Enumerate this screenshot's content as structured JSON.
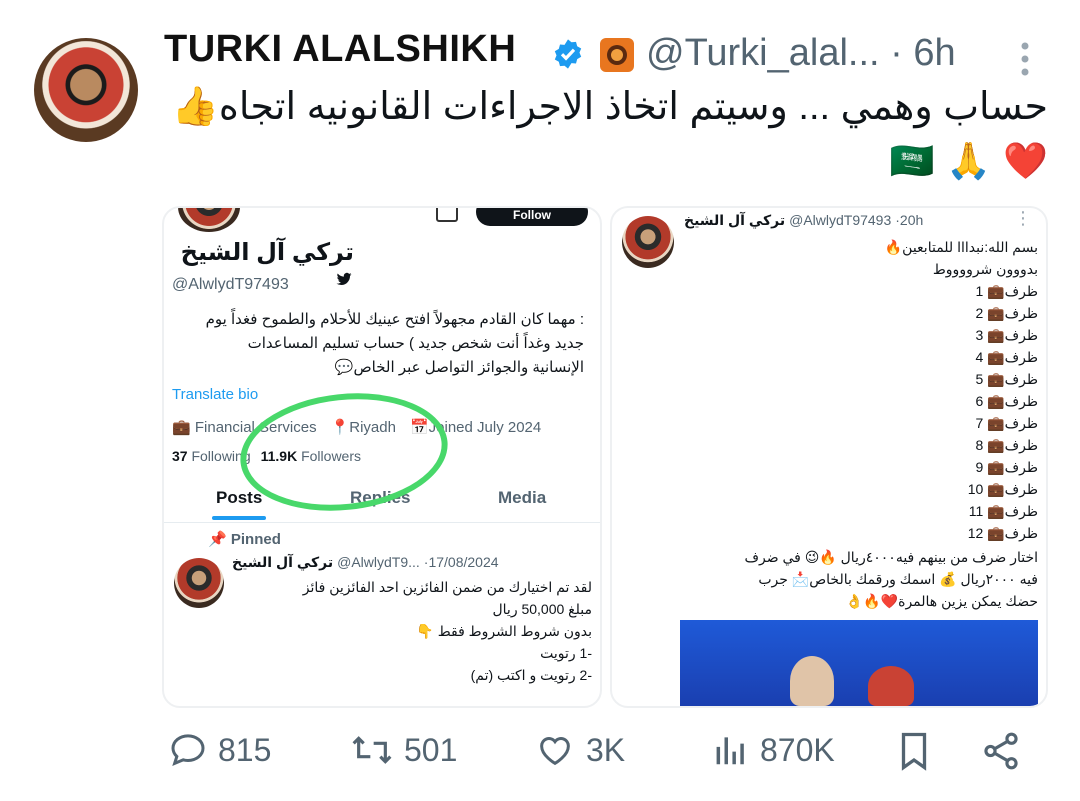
{
  "header": {
    "display_name": "TURKI ALALSHIKH",
    "handle": "@Turki_alal...",
    "time": "· 6h"
  },
  "tweet": {
    "text": "حساب وهمي ... وسيتم اتخاذ الاجراءات القانونيه اتجاه👍",
    "emoji_line": [
      "🇸🇦",
      "🙏",
      "❤️"
    ]
  },
  "left_card": {
    "follow_label": "Follow",
    "profile_name": "تركي آل الشيخ",
    "profile_handle": "@AlwlydT97493",
    "bio_lines": [
      ": مهما كان القادم مجهولاً افتح عينيك للأحلام والطموح فغداً يوم",
      "جديد وغداً أنت شخص جديد ) حساب تسليم المساعدات",
      "الإنسانية والجوائز التواصل عبر الخاص💬"
    ],
    "translate_bio": "Translate bio",
    "category": "Financial Services",
    "location": "Riyadh",
    "joined": "Joined July 2024",
    "following_count": "37",
    "following_label": "Following",
    "followers_count": "11.9K",
    "followers_label": "Followers",
    "tabs": [
      "Posts",
      "Replies",
      "Media"
    ],
    "pinned_label": "Pinned",
    "post": {
      "name": "تركي آل الشيخ",
      "handle": "@AlwlydT9...",
      "date": "·17/08/2024",
      "lines": [
        "لقد تم اختيارك من ضمن الفائزين احد الفائزين فائز",
        "مبلغ 50,000 ريال",
        "بدون شروط الشروط فقط 👇",
        "-1 رتويت",
        "-2 رتويت و اكتب (تم)"
      ]
    }
  },
  "right_card": {
    "name": "تركي آل الشيخ",
    "handle": "@AlwlydT97493",
    "time": "·20h",
    "line1": "بسم الله:نبدااا للمتابعين🔥",
    "line2": "بدووون شرووووط",
    "items": [
      "ظرف💼 1",
      "ظرف💼 2",
      "ظرف💼 3",
      "ظرف💼 4",
      "ظرف💼 5",
      "ظرف💼 6",
      "ظرف💼 7",
      "ظرف💼 8",
      "ظرف💼 9",
      "ظرف💼 10",
      "ظرف💼 11",
      "ظرف💼 12"
    ],
    "footer_lines": [
      "اختار ضرف من بينهم فيه٤٠٠٠ريال 🔥😉 في ضرف",
      "فيه ٢٠٠٠ريال 💰 اسمك ورقمك بالخاص📩 جرب",
      "حضك يمكن يزين هالمرة❤️🔥👌"
    ]
  },
  "actions": {
    "replies": "815",
    "retweets": "501",
    "likes": "3K",
    "views": "870K"
  },
  "colors": {
    "verified": "#1d9bf0",
    "link": "#1d9bf0",
    "annotation_circle": "#48d86a",
    "muted": "#536471"
  }
}
